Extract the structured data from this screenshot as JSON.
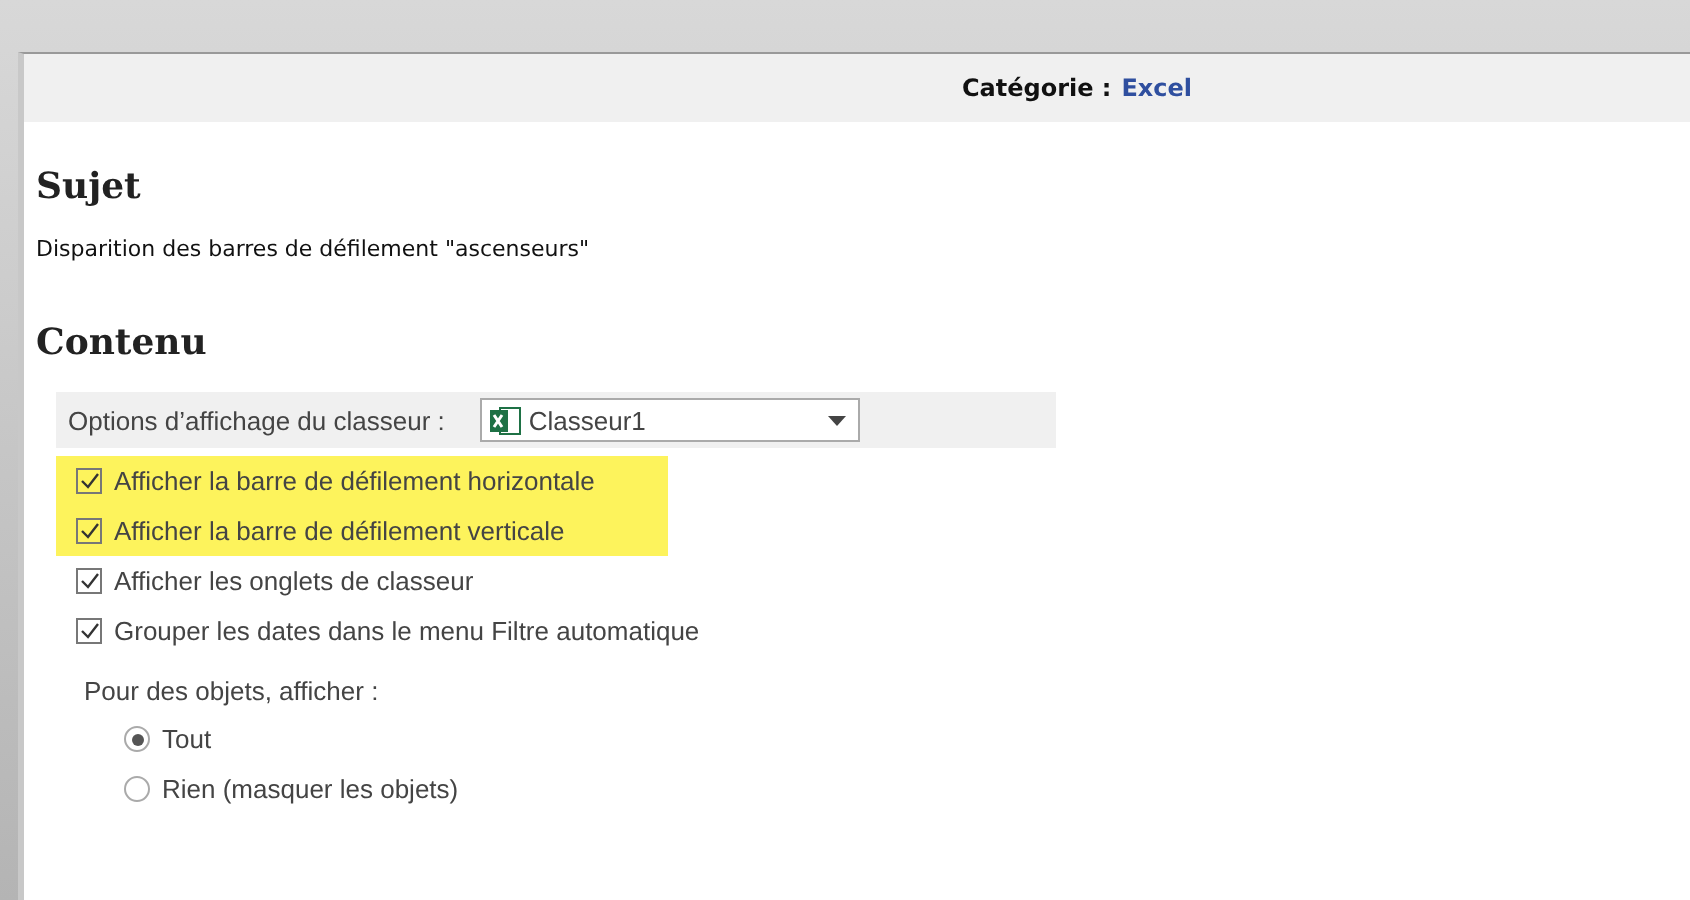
{
  "header": {
    "label": "Catégorie :",
    "value": "Excel"
  },
  "subject": {
    "heading": "Sujet",
    "text": "Disparition des barres de défilement \"ascenseurs\""
  },
  "content": {
    "heading": "Contenu",
    "options_label": "Options d’affichage du classeur :",
    "workbook_select": {
      "value": "Classeur1"
    },
    "checkboxes": [
      {
        "label": "Afficher la barre de défilement horizontale",
        "checked": true,
        "highlighted": true
      },
      {
        "label": "Afficher la barre de défilement verticale",
        "checked": true,
        "highlighted": true
      },
      {
        "label": "Afficher les onglets de classeur",
        "checked": true,
        "highlighted": false
      },
      {
        "label": "Grouper les dates dans le menu Filtre automatique",
        "checked": true,
        "highlighted": false
      }
    ],
    "objects_label": "Pour des objets, afficher :",
    "radios": [
      {
        "label": "Tout",
        "selected": true
      },
      {
        "label": "Rien (masquer les objets)",
        "selected": false
      }
    ]
  }
}
